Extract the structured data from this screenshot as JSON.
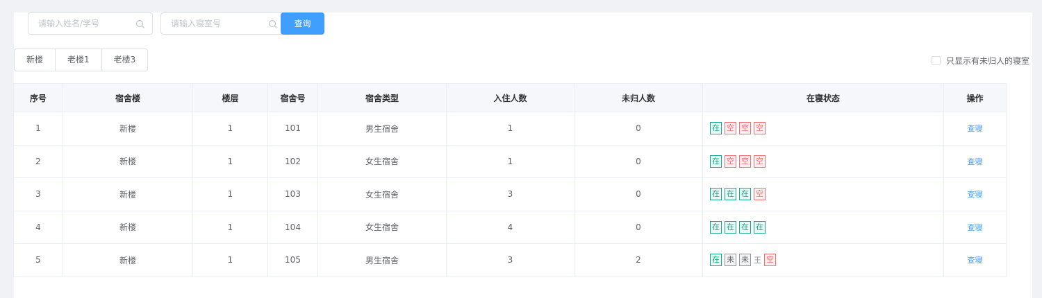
{
  "search": {
    "name_placeholder": "请输入姓名/学号",
    "room_placeholder": "请输入寝室号",
    "query_label": "查询"
  },
  "tabs": [
    "新楼",
    "老楼1",
    "老楼3"
  ],
  "filter": {
    "only_missing_label": "只显示有未归人的寝室",
    "checked": false
  },
  "table": {
    "columns": [
      "序号",
      "宿舍楼",
      "楼层",
      "宿舍号",
      "宿舍类型",
      "入住人数",
      "未归人数",
      "在寝状态",
      "操作"
    ],
    "rows": [
      {
        "no": "1",
        "building": "新楼",
        "floor": "1",
        "room": "101",
        "type": "男生宿舍",
        "occupants": "1",
        "missing": "0",
        "status": [
          {
            "badge": "在",
            "kind": "in",
            "name": ""
          },
          {
            "badge": "空",
            "kind": "empty",
            "name": ""
          },
          {
            "badge": "空",
            "kind": "empty",
            "name": ""
          },
          {
            "badge": "空",
            "kind": "empty",
            "name": ""
          }
        ],
        "action": "查寝"
      },
      {
        "no": "2",
        "building": "新楼",
        "floor": "1",
        "room": "102",
        "type": "女生宿舍",
        "occupants": "1",
        "missing": "0",
        "status": [
          {
            "badge": "在",
            "kind": "in",
            "name": ""
          },
          {
            "badge": "空",
            "kind": "empty",
            "name": ""
          },
          {
            "badge": "空",
            "kind": "empty",
            "name": ""
          },
          {
            "badge": "空",
            "kind": "empty",
            "name": ""
          }
        ],
        "action": "查寝"
      },
      {
        "no": "3",
        "building": "新楼",
        "floor": "1",
        "room": "103",
        "type": "女生宿舍",
        "occupants": "3",
        "missing": "0",
        "status": [
          {
            "badge": "在",
            "kind": "in",
            "name": ""
          },
          {
            "badge": "在",
            "kind": "in",
            "name": ""
          },
          {
            "badge": "在",
            "kind": "in",
            "name": ""
          },
          {
            "badge": "空",
            "kind": "empty",
            "name": ""
          }
        ],
        "action": "查寝"
      },
      {
        "no": "4",
        "building": "新楼",
        "floor": "1",
        "room": "104",
        "type": "女生宿舍",
        "occupants": "4",
        "missing": "0",
        "status": [
          {
            "badge": "在",
            "kind": "in",
            "name": ""
          },
          {
            "badge": "在",
            "kind": "in",
            "name": ""
          },
          {
            "badge": "在",
            "kind": "in",
            "name": ""
          },
          {
            "badge": "在",
            "kind": "in",
            "name": ""
          }
        ],
        "action": "查寝"
      },
      {
        "no": "5",
        "building": "新楼",
        "floor": "1",
        "room": "105",
        "type": "男生宿舍",
        "occupants": "3",
        "missing": "2",
        "status": [
          {
            "badge": "在",
            "kind": "in",
            "name": ""
          },
          {
            "badge": "未",
            "kind": "out",
            "name": ""
          },
          {
            "badge": "未",
            "kind": "out",
            "name": "王"
          },
          {
            "badge": "空",
            "kind": "empty",
            "name": ""
          }
        ],
        "action": "查寝"
      }
    ]
  },
  "colors": {
    "primary": "#409eff",
    "in": "#13a88a",
    "empty": "#f56c6c",
    "out": "#909399"
  },
  "icons": {
    "search": "search-icon"
  }
}
